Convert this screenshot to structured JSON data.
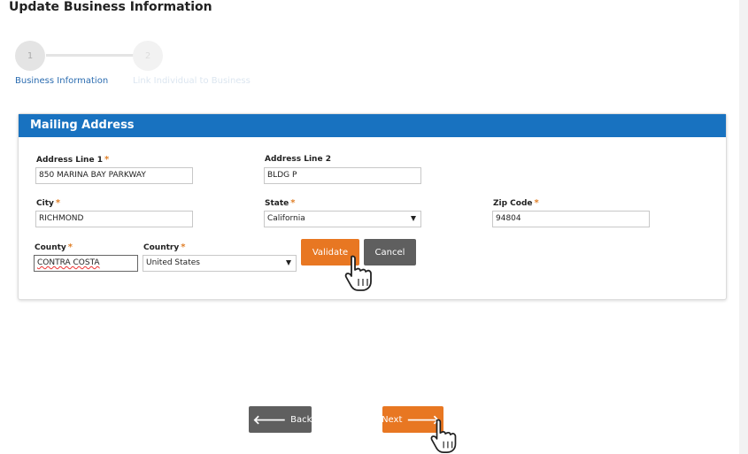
{
  "page": {
    "title": "Update Business Information"
  },
  "stepper": {
    "steps": [
      {
        "number": "1",
        "label": "Business Information"
      },
      {
        "number": "2",
        "label": "Link Individual to Business"
      }
    ]
  },
  "mailing": {
    "header": "Mailing Address",
    "required_mark": "*",
    "address_line1": {
      "label": "Address Line 1",
      "value": "850 MARINA BAY PARKWAY"
    },
    "address_line2": {
      "label": "Address Line 2",
      "value": "BLDG P"
    },
    "city": {
      "label": "City",
      "value": "RICHMOND"
    },
    "state": {
      "label": "State",
      "value": "California"
    },
    "zip": {
      "label": "Zip Code",
      "value": "94804"
    },
    "county": {
      "label": "County",
      "value": "CONTRA COSTA"
    },
    "country": {
      "label": "Country",
      "value": "United States"
    },
    "validate_label": "Validate",
    "cancel_label": "Cancel"
  },
  "nav": {
    "back_label": "Back",
    "next_label": "Next"
  },
  "colors": {
    "accent": "#e87722",
    "header_blue": "#1872c0",
    "gray_button": "#5f5f5f"
  },
  "icons": [
    "hand-pointer-icon",
    "arrow-left-icon",
    "arrow-right-icon",
    "chevron-down-icon"
  ]
}
